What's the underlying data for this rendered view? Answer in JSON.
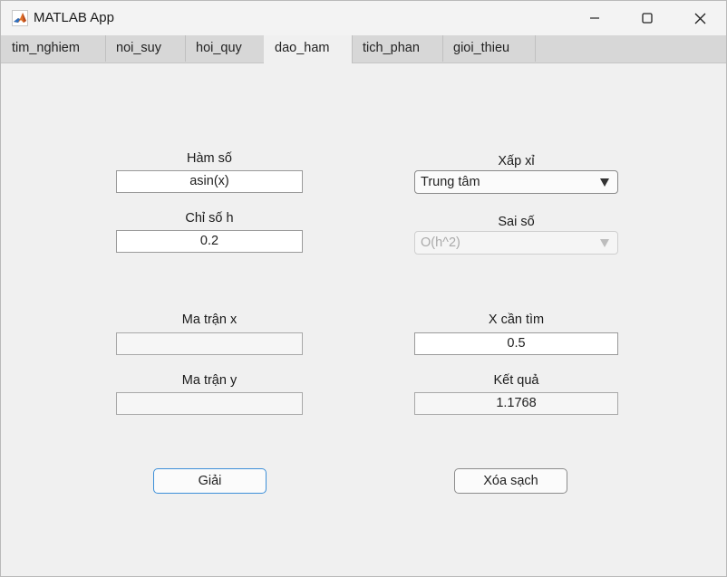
{
  "window": {
    "title": "MATLAB App"
  },
  "tabs": [
    "tim_nghiem",
    "noi_suy",
    "hoi_quy",
    "dao_ham",
    "tich_phan",
    "gioi_thieu"
  ],
  "form": {
    "ham_so_label": "Hàm số",
    "ham_so_value": "asin(x)",
    "chi_so_h_label": "Chỉ số h",
    "chi_so_h_value": "0.2",
    "ma_tran_x_label": "Ma trận x",
    "ma_tran_x_value": "",
    "ma_tran_y_label": "Ma trận y",
    "ma_tran_y_value": "",
    "xap_xi_label": "Xấp xỉ",
    "xap_xi_value": "Trung tâm",
    "sai_so_label": "Sai số",
    "sai_so_value": "O(h^2)",
    "x_can_tim_label": "X cần tìm",
    "x_can_tim_value": "0.5",
    "ket_qua_label": "Kết quả",
    "ket_qua_value": "1.1768"
  },
  "buttons": {
    "solve": "Giải",
    "clear": "Xóa sạch"
  },
  "colors": {
    "accent": "#3d8fd8",
    "tab_active": "#f0f0f0",
    "tab_bar": "#d7d7d7"
  },
  "icons": [
    "matlab-logo-icon",
    "minimize-icon",
    "maximize-icon",
    "close-icon",
    "chevron-down-icon"
  ]
}
